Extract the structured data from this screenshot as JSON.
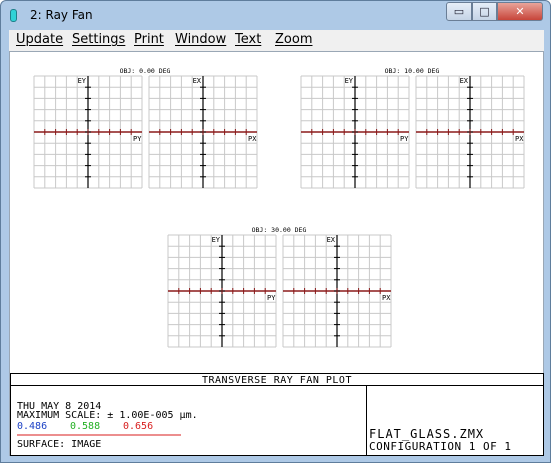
{
  "window": {
    "title": "2: Ray Fan",
    "controls": {
      "minimize": "▭",
      "maximize": "□",
      "close": "✕"
    }
  },
  "menu": [
    "Update",
    "Settings",
    "Print",
    "Window",
    "Text",
    "Zoom"
  ],
  "plots": {
    "fields": [
      "OBJ: 0.00 DEG",
      "OBJ: 10.00 DEG",
      "OBJ: 30.00 DEG"
    ],
    "tangential_axes": {
      "vertical": "EY",
      "horizontal": "PY"
    },
    "sagittal_axes": {
      "vertical": "EX",
      "horizontal": "PX"
    }
  },
  "footer": {
    "plot_title": "TRANSVERSE RAY FAN PLOT",
    "date": "THU MAY 8 2014",
    "max_scale": "MAXIMUM SCALE: ± 1.00E-005 µm.",
    "wavelengths": [
      {
        "label": "0.486",
        "color": "#1a3fc4"
      },
      {
        "label": "0.588",
        "color": "#22b022"
      },
      {
        "label": "0.656",
        "color": "#d81e1e"
      }
    ],
    "surface": "SURFACE: IMAGE",
    "file": "FLAT_GLASS.ZMX",
    "configuration": "CONFIGURATION 1 OF 1"
  },
  "colors": {
    "grid": "#c8c8c8",
    "axis": "#000000",
    "ray_line": "#8b1a1a"
  }
}
